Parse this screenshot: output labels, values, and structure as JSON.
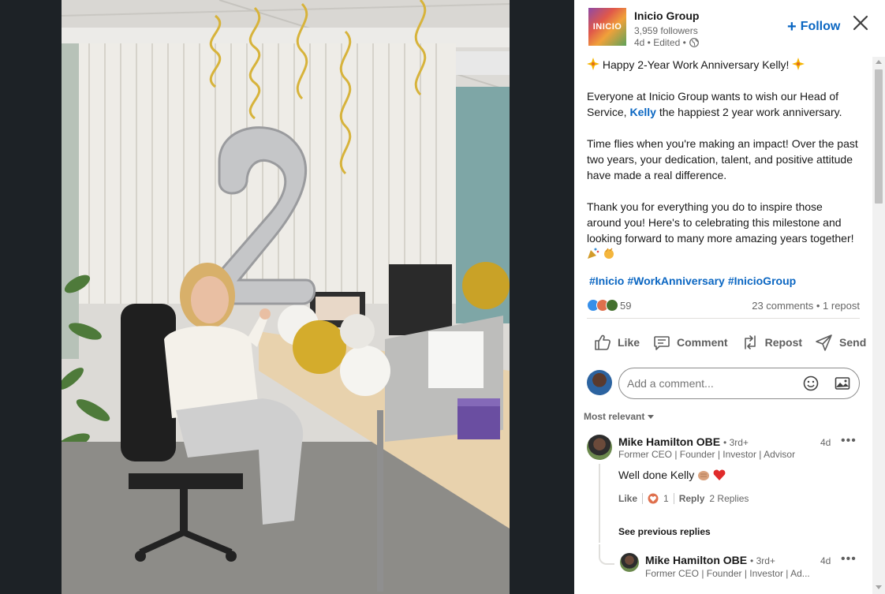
{
  "post": {
    "company_name": "Inicio Group",
    "logo_text": "INICIO",
    "followers": "3,959 followers",
    "posted_meta": "4d • Edited •",
    "follow_label": "Follow",
    "heading": "Happy 2-Year Work Anniversary Kelly!",
    "para2_before": "Everyone at Inicio Group wants to wish our Head of Service, ",
    "para2_mention": "Kelly",
    "para2_after": " the happiest 2 year work anniversary.",
    "para3": "Time flies when you're making an impact! Over the past two years, your dedication, talent, and positive attitude have made a real difference.",
    "para4": "Thank you for everything you do to inspire those around you! Here's to celebrating this milestone and looking forward to many more amazing years together!",
    "hashtags": [
      "#Inicio",
      "#WorkAnniversary",
      "#InicioGroup"
    ],
    "reaction_count": "59",
    "comments_reposts": "23 comments • 1 repost"
  },
  "actions": {
    "like": "Like",
    "comment": "Comment",
    "repost": "Repost",
    "send": "Send"
  },
  "comment_box": {
    "placeholder": "Add a comment..."
  },
  "sort_label": "Most relevant",
  "comments": [
    {
      "name": "Mike Hamilton OBE",
      "degree": "• 3rd+",
      "headline": "Former CEO | Founder | Investor | Advisor",
      "time": "4d",
      "text": "Well done Kelly",
      "like_label": "Like",
      "like_count": "1",
      "reply_label": "Reply",
      "replies": "2 Replies"
    }
  ],
  "see_previous": "See previous replies",
  "reply": {
    "name": "Mike Hamilton OBE",
    "degree": "• 3rd+",
    "headline": "Former CEO | Founder | Investor | Ad...",
    "time": "4d"
  },
  "colors": {
    "brand_blue": "#0a66c2",
    "page_bg": "#1b1f23"
  }
}
